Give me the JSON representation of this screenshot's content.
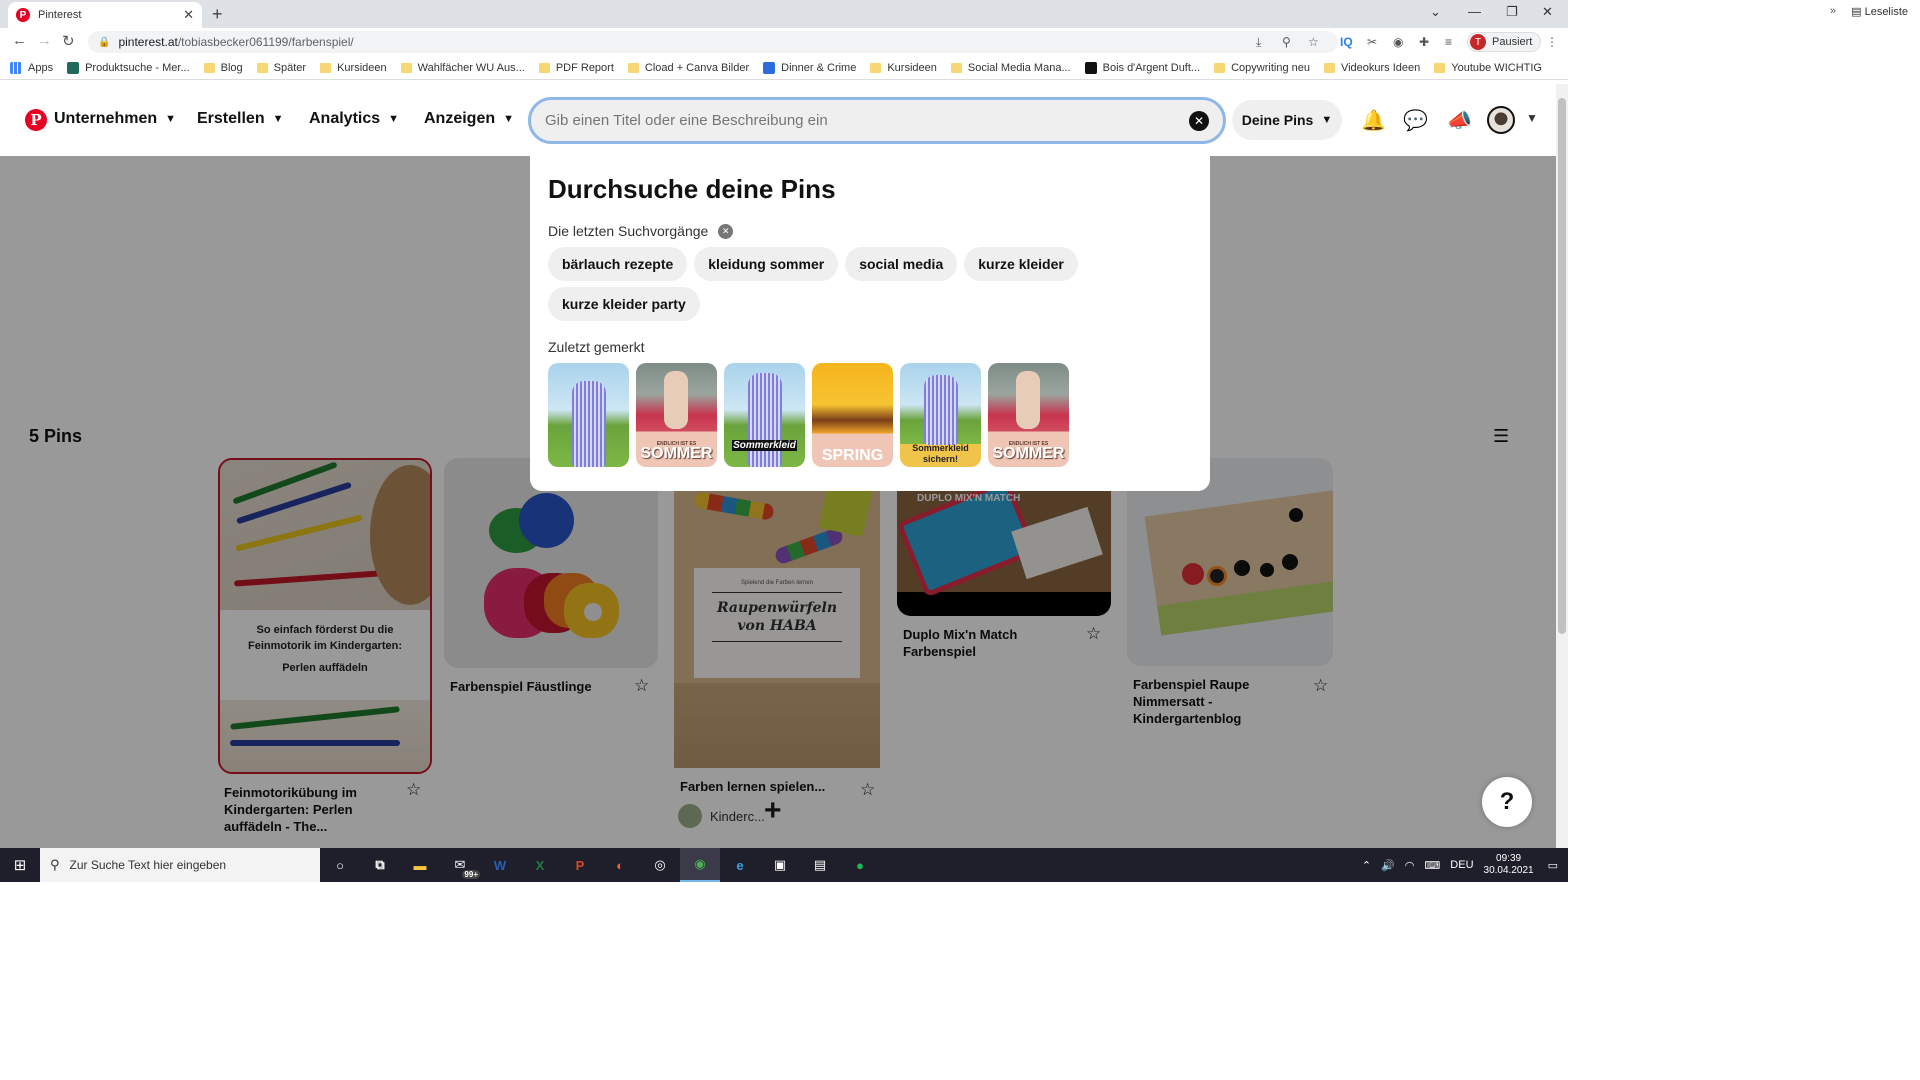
{
  "browser": {
    "tab_title": "Pinterest",
    "url_host": "pinterest.at",
    "url_path": "/tobiasbecker061199/farbenspiel/",
    "profile_label": "Pausiert",
    "profile_initial": "T",
    "bookmarks": [
      {
        "label": "Apps",
        "type": "apps"
      },
      {
        "label": "Produktsuche - Mer...",
        "type": "site"
      },
      {
        "label": "Blog",
        "type": "folder"
      },
      {
        "label": "Später",
        "type": "folder"
      },
      {
        "label": "Kursideen",
        "type": "folder"
      },
      {
        "label": "Wahlfächer WU Aus...",
        "type": "folder"
      },
      {
        "label": "PDF Report",
        "type": "folder"
      },
      {
        "label": "Cload + Canva Bilder",
        "type": "folder"
      },
      {
        "label": "Dinner & Crime",
        "type": "site"
      },
      {
        "label": "Kursideen",
        "type": "folder"
      },
      {
        "label": "Social Media Mana...",
        "type": "folder"
      },
      {
        "label": "Bois d'Argent Duft...",
        "type": "site"
      },
      {
        "label": "Copywriting neu",
        "type": "folder"
      },
      {
        "label": "Videokurs Ideen",
        "type": "folder"
      },
      {
        "label": "Youtube WICHTIG",
        "type": "folder"
      }
    ],
    "bookmarks_more": "»",
    "reading_list": "Leseliste"
  },
  "header": {
    "logo": "P",
    "nav": [
      "Unternehmen",
      "Erstellen",
      "Analytics",
      "Anzeigen"
    ],
    "search_placeholder": "Gib einen Titel oder eine Beschreibung ein",
    "search_value": "",
    "scope_button": "Deine Pins"
  },
  "dropdown": {
    "title": "Durchsuche deine Pins",
    "recent_label": "Die letzten Suchvorgänge",
    "recent_searches": [
      "bärlauch rezepte",
      "kleidung sommer",
      "social media",
      "kurze kleider",
      "kurze kleider party"
    ],
    "saved_label": "Zuletzt gemerkt",
    "saved_thumbs": [
      {
        "caption": ""
      },
      {
        "caption": "SOMMER",
        "subcaption": "ENDLICH IST ES"
      },
      {
        "caption": "Sommerkleid"
      },
      {
        "caption": "SPRING"
      },
      {
        "caption": "Sommerkleid sichern!"
      },
      {
        "caption": "SOMMER",
        "subcaption": "ENDLICH IST ES"
      }
    ]
  },
  "board": {
    "pin_count": "5 Pins",
    "pins": [
      {
        "title": "Feinmotorikübung im Kindergarten: Perlen auffädeln - The...",
        "image_text": [
          "So einfach förderst Du die",
          "Feinmotorik im Kindergarten:",
          "Perlen auffädeln"
        ]
      },
      {
        "title": "Farbenspiel Fäustlinge"
      },
      {
        "title": "Farben lernen spielen...",
        "author": "Kinderc...",
        "image_text": [
          "Spielend die Farben lernen",
          "Raupenwürfeln von HABA"
        ]
      },
      {
        "title": "Duplo Mix'n Match Farbenspiel",
        "image_text": [
          "DUPLO MIX'N MATCH"
        ]
      },
      {
        "title": "Farbenspiel Raupe Nimmersatt - Kindergartenblog"
      }
    ]
  },
  "help_label": "?",
  "add_label": "+",
  "taskbar": {
    "search_placeholder": "Zur Suche Text hier eingeben",
    "mail_badge": "99+",
    "language": "DEU",
    "time": "09:39",
    "date": "30.04.2021"
  }
}
